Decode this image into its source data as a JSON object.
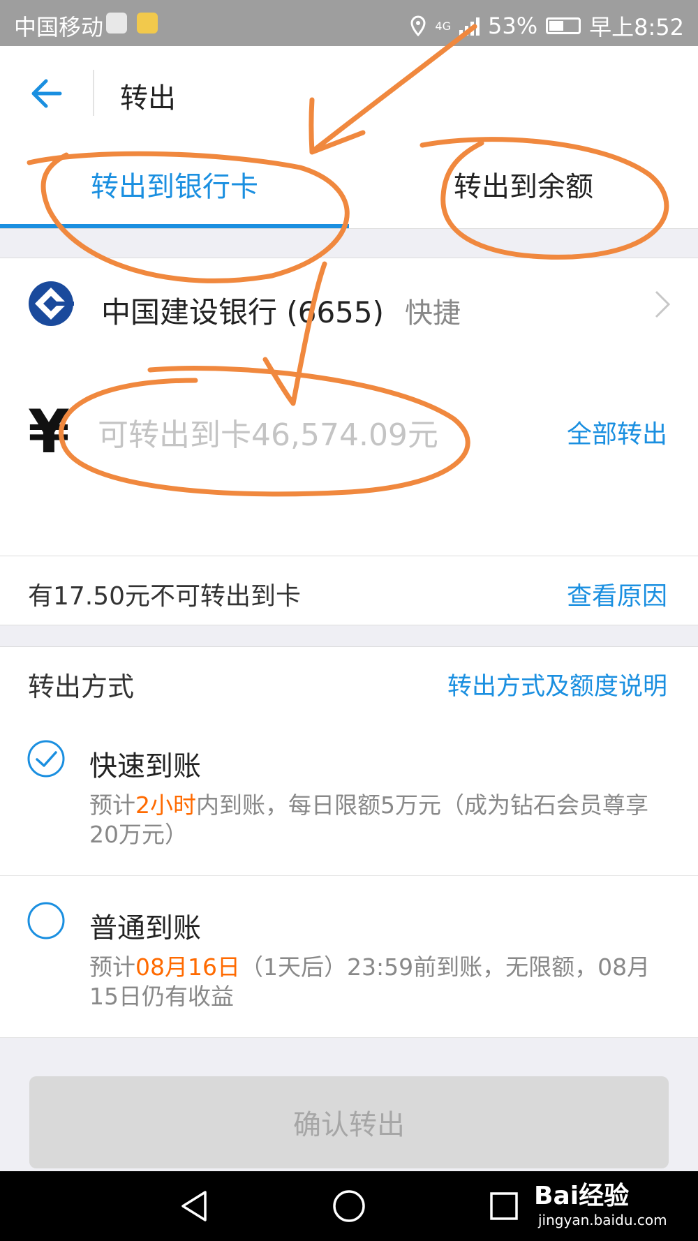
{
  "status_bar": {
    "carrier": "中国移动",
    "network": "4G",
    "battery": "53%",
    "time": "早上8:52"
  },
  "header": {
    "title": "转出"
  },
  "tabs": [
    {
      "label": "转出到银行卡",
      "active": true
    },
    {
      "label": "转出到余额",
      "active": false
    }
  ],
  "bank": {
    "name": "中国建设银行 (6655)",
    "tag": "快捷"
  },
  "amount": {
    "currency_symbol": "¥",
    "placeholder": "可转出到卡46,574.09元",
    "value": "",
    "all_out_label": "全部转出"
  },
  "notice": {
    "text": "有17.50元不可转出到卡",
    "link": "查看原因"
  },
  "method": {
    "title": "转出方式",
    "link": "转出方式及额度说明"
  },
  "options": [
    {
      "title": "快速到账",
      "selected": true,
      "desc_prefix": "预计",
      "desc_highlight": "2小时",
      "desc_suffix": "内到账，每日限额5万元（成为钻石会员尊享20万元）"
    },
    {
      "title": "普通到账",
      "selected": false,
      "desc_prefix": "预计",
      "desc_highlight": "08月16日",
      "desc_suffix": "（1天后）23:59前到账，无限额，08月15日仍有收益"
    }
  ],
  "confirm_label": "确认转出",
  "watermark": {
    "main": "Bai经验",
    "sub": "jingyan.baidu.com"
  },
  "colors": {
    "accent": "#1a8fe0",
    "highlight": "#ff6a00",
    "annotation": "#f0883e",
    "status_bar": "#9e9e9e"
  }
}
